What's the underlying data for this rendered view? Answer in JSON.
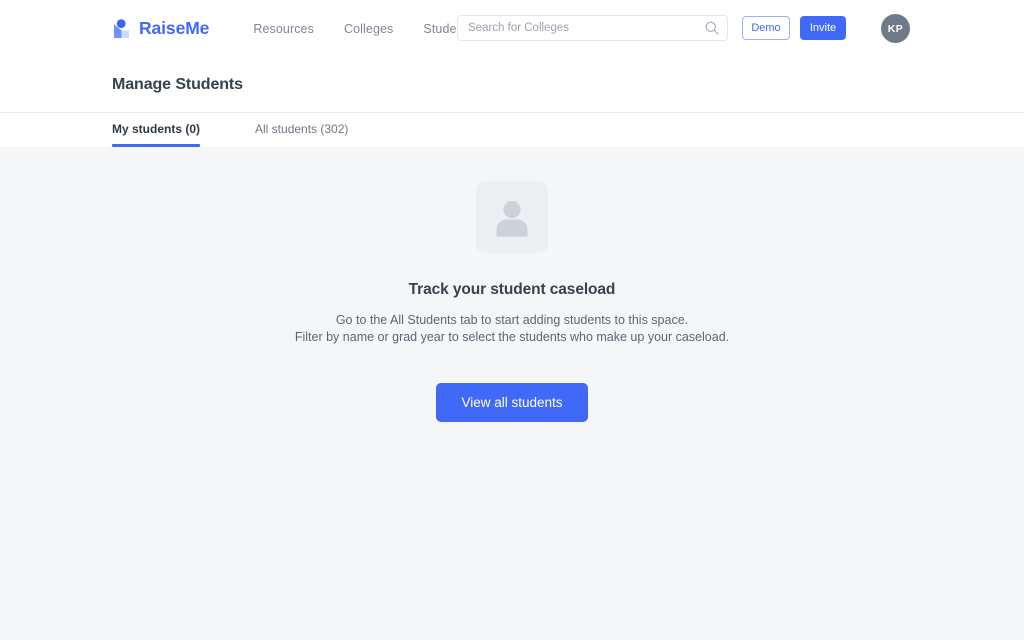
{
  "header": {
    "brand": {
      "logo_icon": "raiseme-logo-icon",
      "name": "RaiseMe",
      "brand_color": "#4169f7"
    },
    "nav_links": [
      {
        "label": "Resources"
      },
      {
        "label": "Colleges"
      },
      {
        "label": "Students"
      }
    ],
    "search": {
      "placeholder": "Search for Colleges",
      "value": "",
      "icon": "search-icon"
    },
    "demo_button": {
      "label": "Demo"
    },
    "invite_button": {
      "label": "Invite"
    },
    "avatar": {
      "initials": "KP",
      "color": "#6e7a88"
    }
  },
  "page": {
    "title": "Manage Students"
  },
  "tabs": [
    {
      "label": "My students (0)",
      "active": true
    },
    {
      "label": "All students (302)",
      "active": false
    }
  ],
  "empty_state": {
    "icon": "person-placeholder-icon",
    "title": "Track your student caseload",
    "line1": "Go to the All Students tab to start adding students to this space.",
    "line2": "Filter by name or grad year to select the students who make up your caseload.",
    "cta_label": "View all students",
    "cta_color": "#4169f7"
  }
}
